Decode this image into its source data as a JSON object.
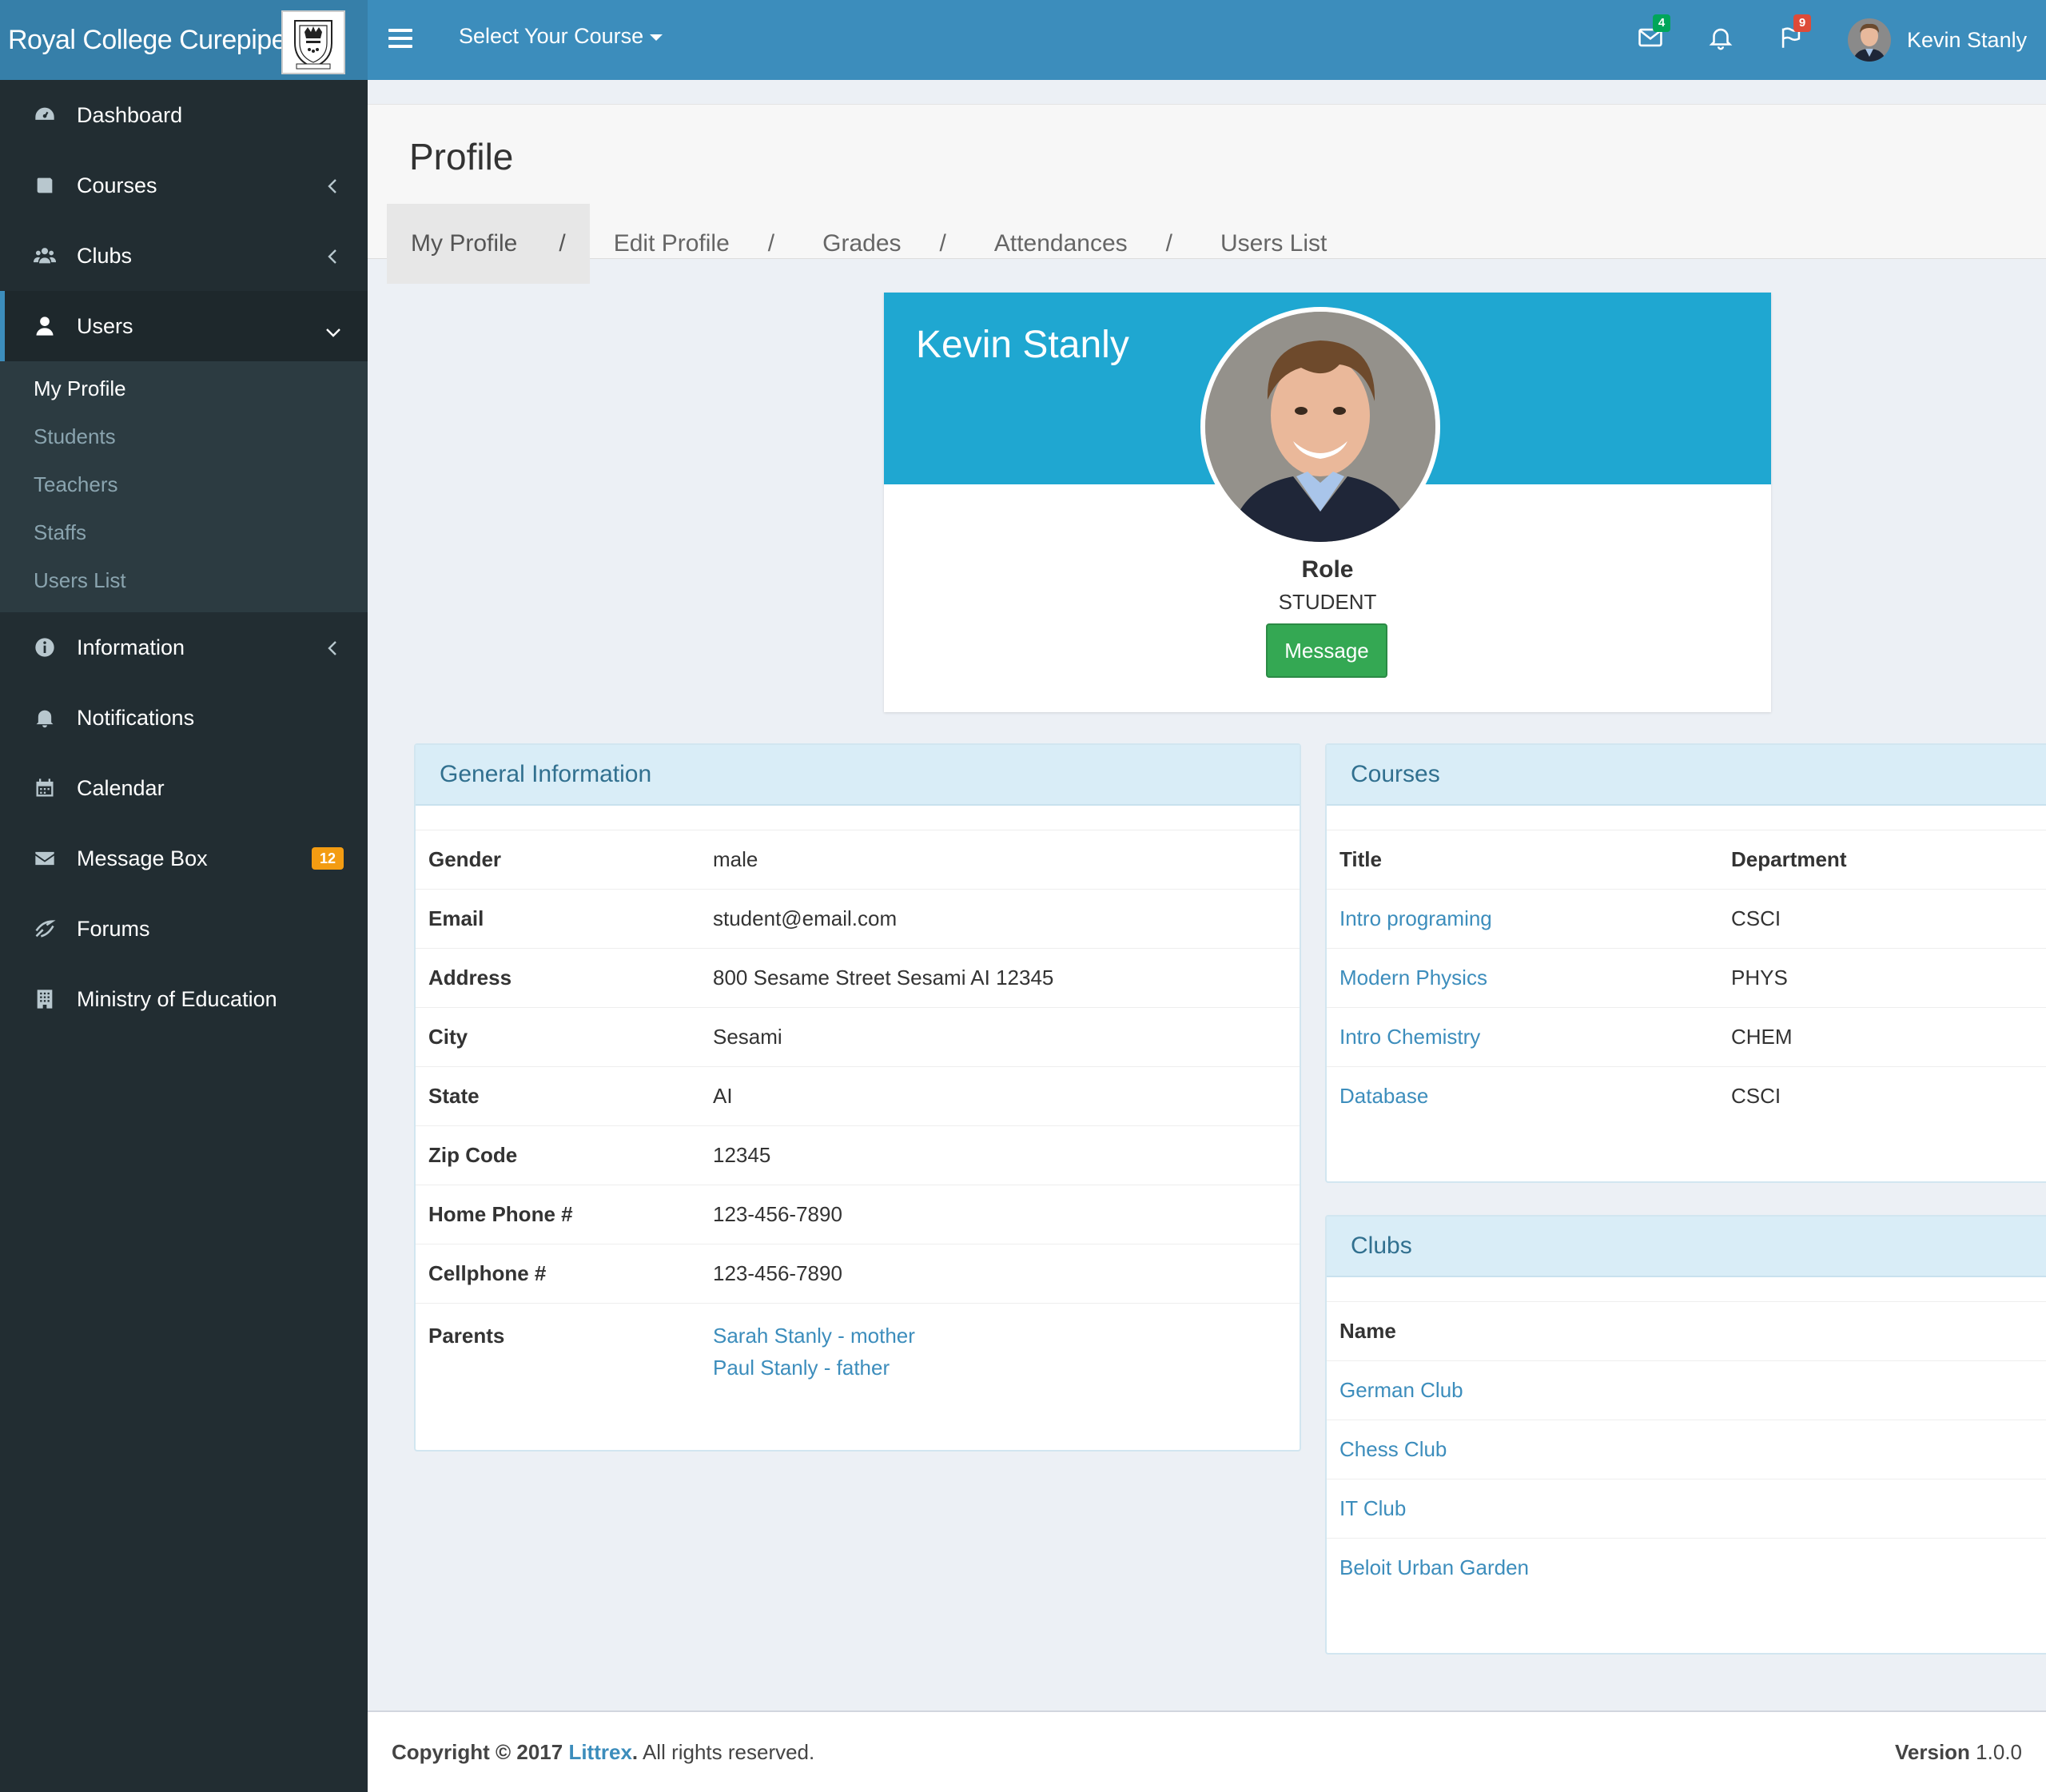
{
  "header": {
    "brand": "Royal College Curepipe",
    "course_select": "Select Your Course",
    "mail_badge": "4",
    "flag_badge": "9",
    "user_name": "Kevin Stanly",
    "colors": {
      "bar": "#3c8dbc",
      "brand_bg": "#367fa9",
      "mail_badge": "#00a65a",
      "flag_badge": "#dd4b39"
    }
  },
  "sidebar": {
    "items": [
      {
        "label": "Dashboard",
        "icon": "dashboard-icon"
      },
      {
        "label": "Courses",
        "icon": "book-icon"
      },
      {
        "label": "Clubs",
        "icon": "users-group-icon"
      },
      {
        "label": "Users",
        "icon": "user-icon"
      },
      {
        "label": "Information",
        "icon": "info-icon"
      },
      {
        "label": "Notifications",
        "icon": "bell-icon"
      },
      {
        "label": "Calendar",
        "icon": "calendar-icon"
      },
      {
        "label": "Message Box",
        "icon": "envelope-icon",
        "badge": "12"
      },
      {
        "label": "Forums",
        "icon": "forums-icon"
      },
      {
        "label": "Ministry of Education",
        "icon": "building-icon"
      }
    ],
    "users_submenu": [
      "My Profile",
      "Students",
      "Teachers",
      "Staffs",
      "Users List"
    ]
  },
  "page": {
    "title": "Profile",
    "tabs": [
      "My Profile",
      "Edit Profile",
      "Grades",
      "Attendances",
      "Users List"
    ],
    "separator": "/"
  },
  "profile": {
    "name": "Kevin Stanly",
    "role_label": "Role",
    "role": "STUDENT",
    "message_button": "Message",
    "banner_color": "#1fa7d1"
  },
  "general_info": {
    "title": "General Information",
    "rows": [
      {
        "key": "Gender",
        "value": "male"
      },
      {
        "key": "Email",
        "value": "student@email.com"
      },
      {
        "key": "Address",
        "value": "800 Sesame Street Sesami AI 12345"
      },
      {
        "key": "City",
        "value": "Sesami"
      },
      {
        "key": "State",
        "value": "AI"
      },
      {
        "key": "Zip Code",
        "value": "12345"
      },
      {
        "key": "Home Phone #",
        "value": "123-456-7890"
      },
      {
        "key": "Cellphone #",
        "value": "123-456-7890"
      }
    ],
    "parents_label": "Parents",
    "parents": [
      "Sarah Stanly - mother",
      "Paul Stanly - father"
    ]
  },
  "courses": {
    "title": "Courses",
    "columns": [
      "Title",
      "Department"
    ],
    "rows": [
      {
        "title": "Intro programing",
        "department": "CSCI"
      },
      {
        "title": "Modern Physics",
        "department": "PHYS"
      },
      {
        "title": "Intro Chemistry",
        "department": "CHEM"
      },
      {
        "title": "Database",
        "department": "CSCI"
      }
    ]
  },
  "clubs": {
    "title": "Clubs",
    "column": "Name",
    "rows": [
      "German Club",
      "Chess Club",
      "IT Club",
      "Beloit Urban Garden"
    ]
  },
  "footer": {
    "copyright_prefix": "Copyright © 2017",
    "company": "Littrex",
    "suffix": ". All rights reserved.",
    "version_label": "Version",
    "version": "1.0.0"
  }
}
